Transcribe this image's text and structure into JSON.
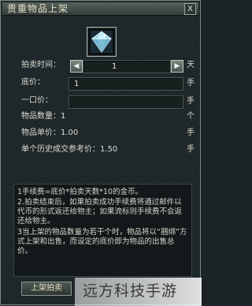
{
  "window": {
    "title": "贵重物品上架",
    "close_label": "X"
  },
  "item_slot": {
    "icon": "diamond-gem-icon",
    "accent": "#9ed3e6"
  },
  "form": {
    "auction_time": {
      "label": "拍卖时间：",
      "value": "1",
      "unit": "天",
      "decrease_icon": "arrow-left-icon",
      "increase_icon": "arrow-right-icon"
    },
    "base_price": {
      "label": "底价：",
      "value": "1",
      "unit": "手"
    },
    "buyout_price": {
      "label": "一口价：",
      "value": "",
      "unit": "手"
    },
    "item_count": {
      "label": "物品数量：1",
      "unit": "个"
    },
    "item_unit_price": {
      "label": "物品单价：1.00",
      "unit": "手"
    },
    "history_price": {
      "label": "单个历史成交参考价：1.50",
      "unit": "手"
    }
  },
  "description": [
    "1手续费=底价*拍卖天数*10的金币。",
    "2.拍卖结束后，如果拍卖成功手续费将通过邮件以代币的形式返还给物主；如果流标则手续费不会返还给物主。",
    "3当上架的物品数量为若干个时，物品将以“捆绑”方式上架和出售，而设定的底价即为物品的出售总价。"
  ],
  "bottom": {
    "list_button": "上架拍卖"
  },
  "watermark": "远方科技手游"
}
